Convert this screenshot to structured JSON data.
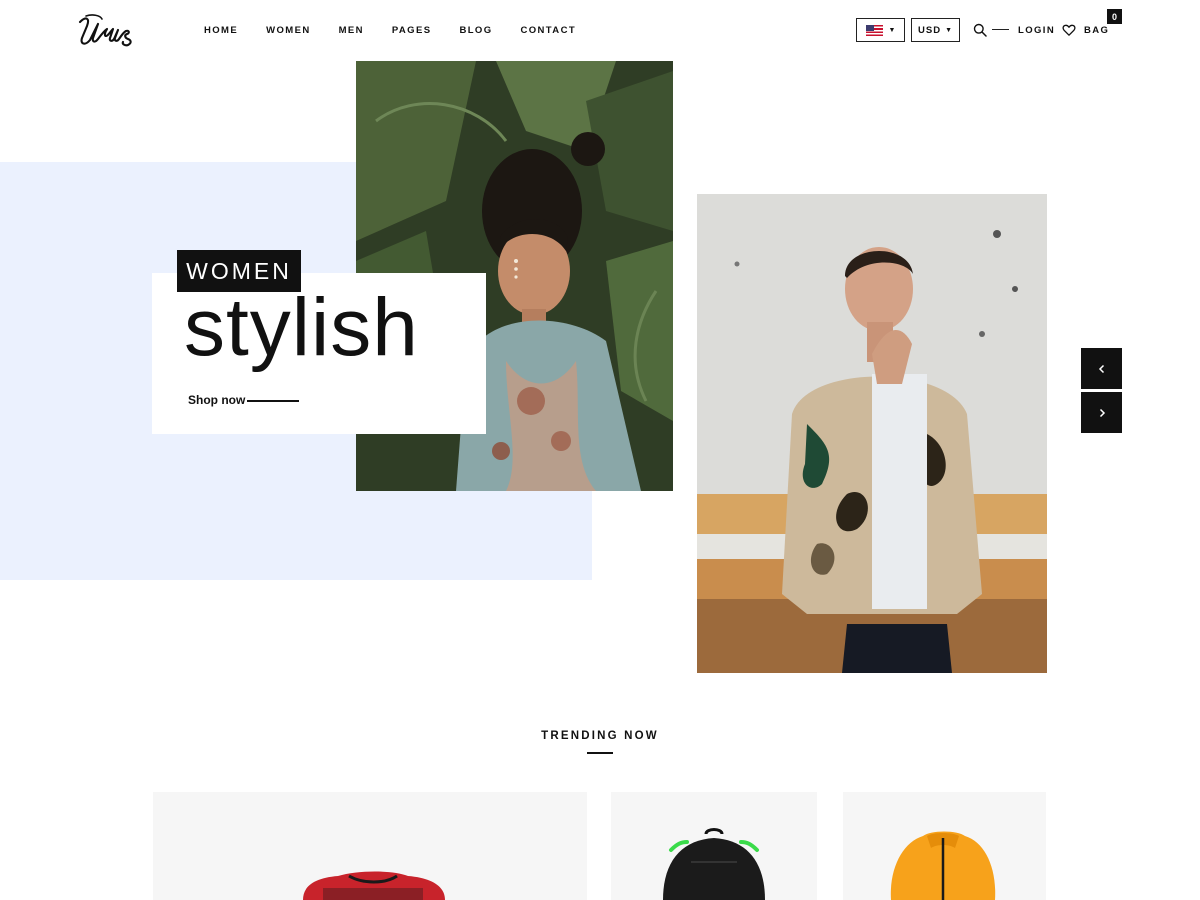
{
  "header": {
    "logo_text": "Urus",
    "nav": [
      "HOME",
      "WOMEN",
      "MEN",
      "PAGES",
      "BLOG",
      "CONTACT"
    ],
    "currency": "USD",
    "login": "LOGIN",
    "bag": "BAG",
    "bag_count": "0"
  },
  "hero": {
    "category": "WOMEN",
    "title": "stylish",
    "cta": "Shop now",
    "colors": {
      "background_panel": "#ebf1fe",
      "accent": "#111111"
    }
  },
  "trending": {
    "title": "TRENDING NOW"
  },
  "icons": [
    "us-flag-icon",
    "chevron-down-icon",
    "search-icon",
    "heart-icon",
    "chevron-left-icon",
    "chevron-right-icon"
  ]
}
